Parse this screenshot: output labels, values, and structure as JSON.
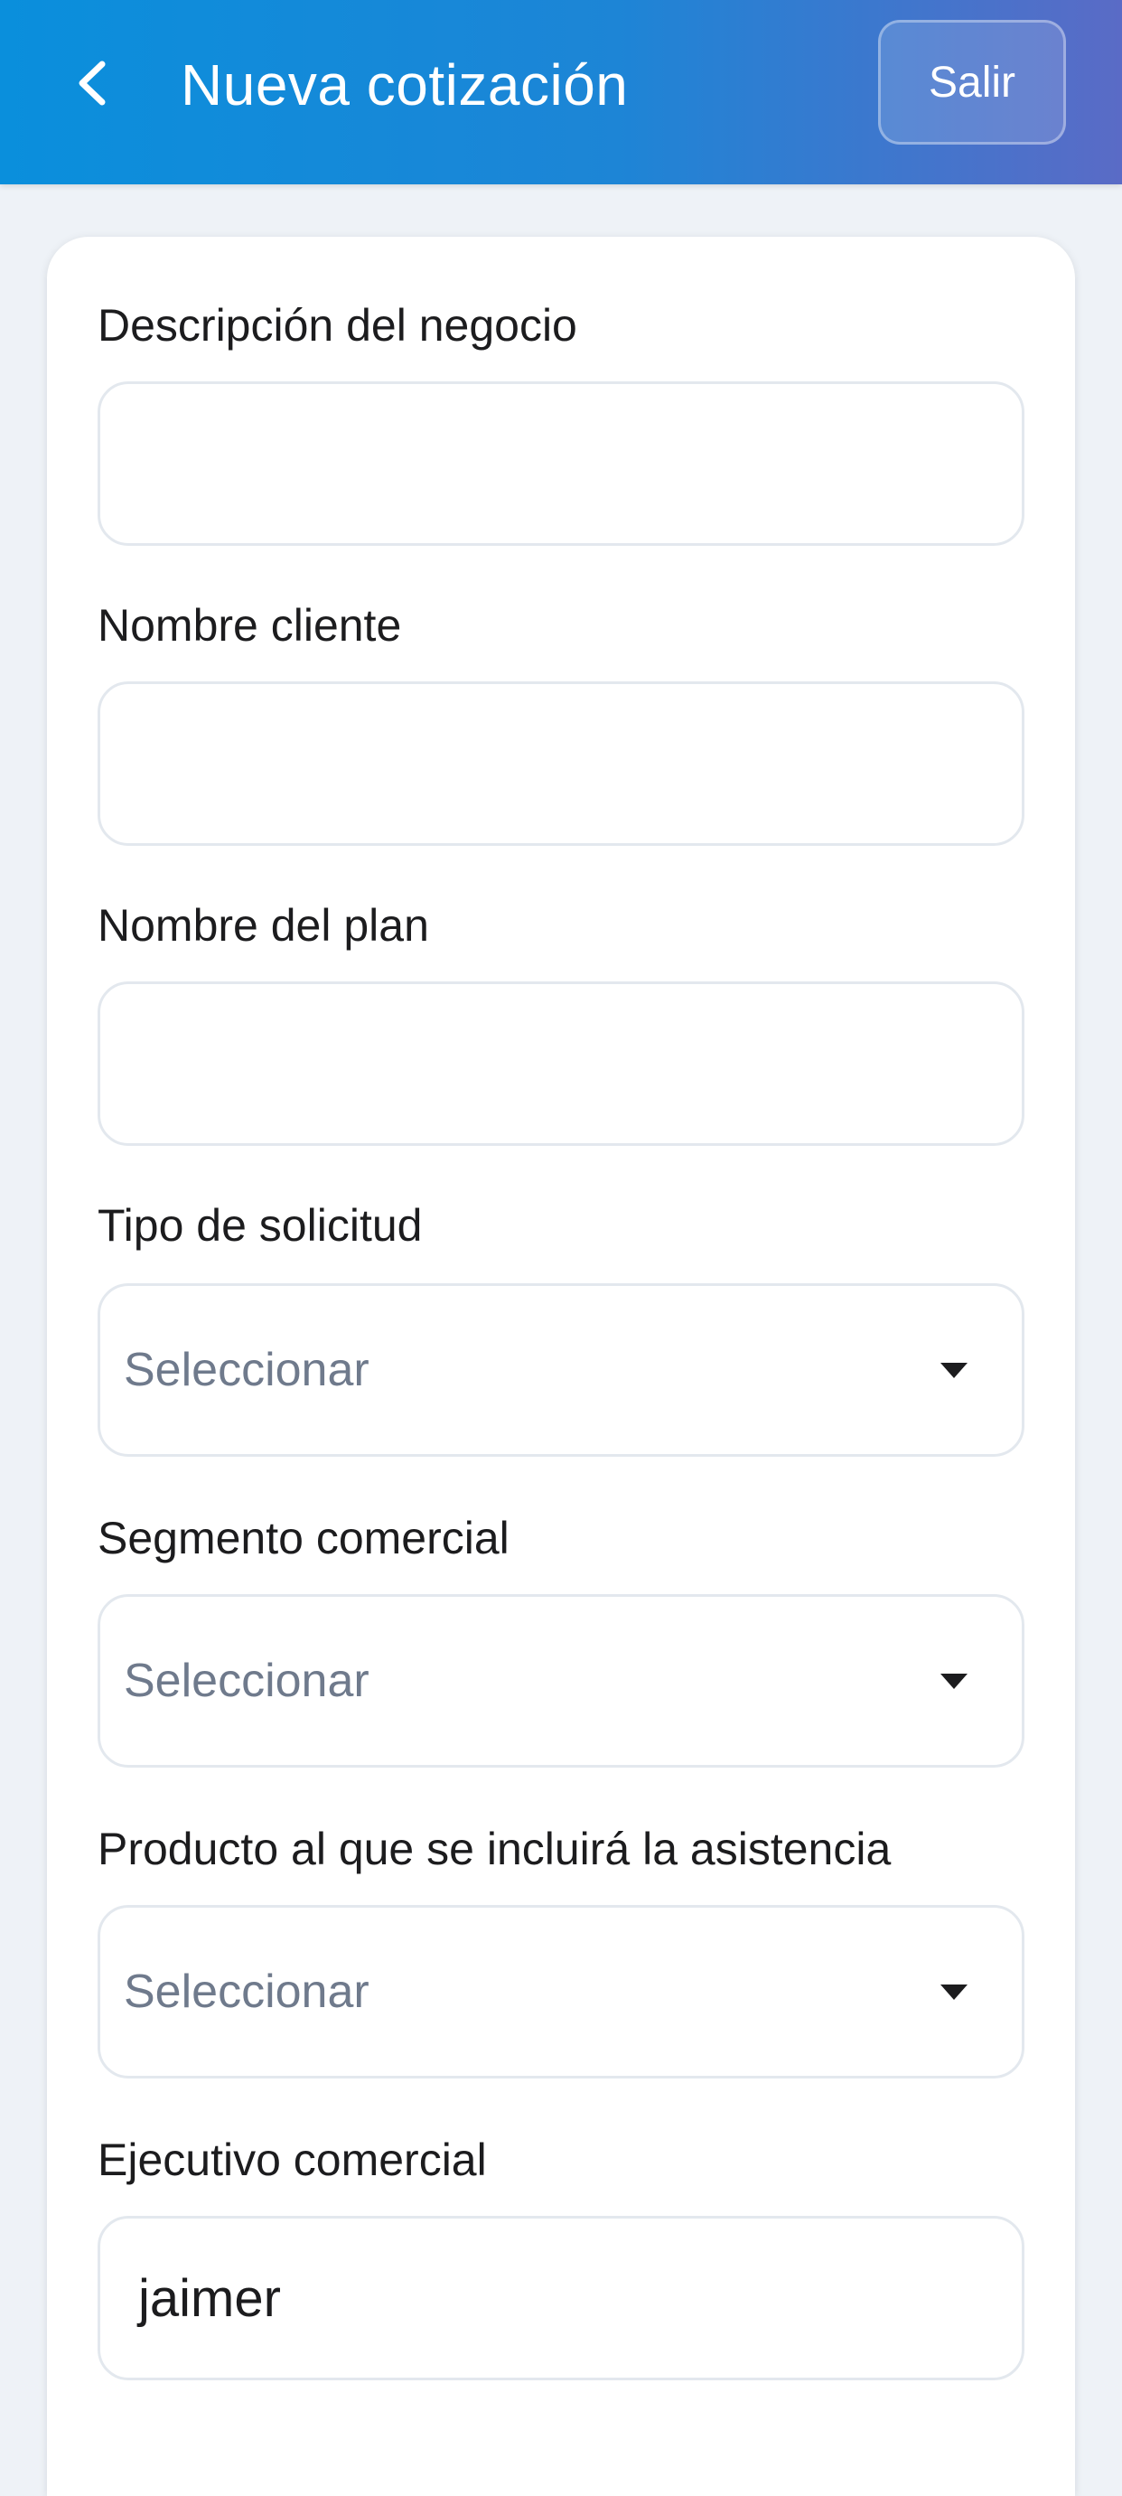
{
  "header": {
    "back_symbol": "<",
    "title": "Nueva cotización",
    "exit_label": "Salir"
  },
  "form": {
    "business_description": {
      "label": "Descripción del negocio",
      "value": ""
    },
    "client_name": {
      "label": "Nombre cliente",
      "value": ""
    },
    "plan_name": {
      "label": "Nombre del plan",
      "value": ""
    },
    "request_type": {
      "label": "Tipo de solicitud",
      "placeholder": "Seleccionar"
    },
    "commercial_segment": {
      "label": "Segmento comercial",
      "placeholder": "Seleccionar"
    },
    "product": {
      "label": "Producto al que se incluirá la asistencia",
      "placeholder": "Seleccionar"
    },
    "executive": {
      "label": "Ejecutivo comercial",
      "value": "jaimer"
    }
  },
  "colors": {
    "header_gradient_start": "#0a8fdc",
    "header_gradient_end": "#5a6bc6",
    "page_background": "#eef2f7",
    "placeholder_text": "#6f7a8c"
  },
  "icons": {
    "back": "chevron-left-icon",
    "dropdown": "caret-down-icon"
  }
}
